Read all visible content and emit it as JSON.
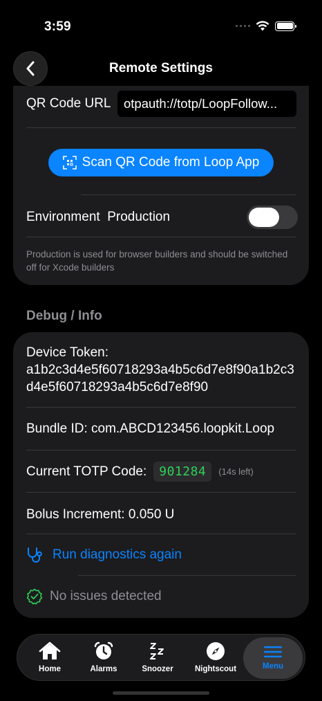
{
  "status_bar": {
    "time": "3:59"
  },
  "nav": {
    "title": "Remote Settings",
    "back_icon": "chevron-left-icon"
  },
  "settings": {
    "qr_label": "QR Code URL",
    "qr_value": "otpauth://totp/LoopFollow...",
    "scan_button": "Scan QR Code from Loop App",
    "env_label": "Environment  Production",
    "env_toggle_on": false,
    "env_note": "Production is used for browser builders and should be switched off for Xcode builders"
  },
  "debug": {
    "header": "Debug / Info",
    "device_token_label": "Device Token:",
    "device_token": "a1b2c3d4e5f60718293a4b5c6d7e8f90a1b2c3d4e5f60718293a4b5c6d7e8f90",
    "bundle_id": "Bundle ID: com.ABCD123456.loopkit.Loop",
    "totp_label": "Current TOTP Code:",
    "totp_code": "901284",
    "totp_left": "(14s left)",
    "bolus": "Bolus Increment: 0.050 U",
    "diagnostics": "Run diagnostics again",
    "issues": "No issues detected"
  },
  "tabs": [
    {
      "label": "Home",
      "icon": "house-icon"
    },
    {
      "label": "Alarms",
      "icon": "alarm-clock-icon"
    },
    {
      "label": "Snoozer",
      "icon": "zzz-icon"
    },
    {
      "label": "Nightscout",
      "icon": "compass-icon"
    },
    {
      "label": "Menu",
      "icon": "menu-lines-icon",
      "active": true
    }
  ],
  "colors": {
    "accent": "#0a84ff",
    "code_green": "#30d158",
    "card": "#1c1c1e"
  }
}
